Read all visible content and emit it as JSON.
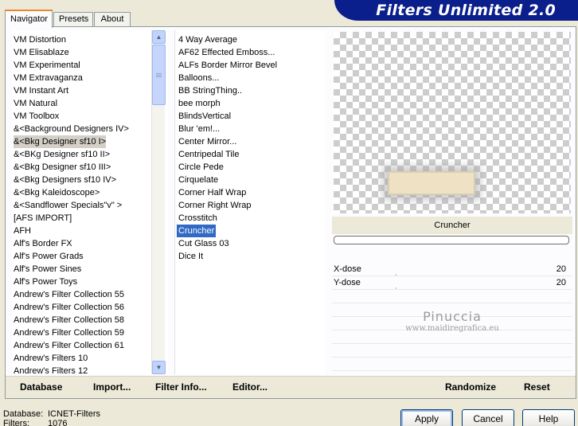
{
  "app": {
    "banner_title": "Filters Unlimited 2.0"
  },
  "tabs": [
    {
      "label": "Navigator",
      "active": true
    },
    {
      "label": "Presets",
      "active": false
    },
    {
      "label": "About",
      "active": false
    }
  ],
  "categories": {
    "items": [
      "VM Distortion",
      "VM Elisablaze",
      "VM Experimental",
      "VM Extravaganza",
      "VM Instant Art",
      "VM Natural",
      "VM Toolbox",
      "&<Background Designers IV>",
      "&<Bkg Designer sf10 I>",
      "&<BKg Designer sf10 II>",
      "&<Bkg Designer sf10 III>",
      "&<Bkg Designers sf10 IV>",
      "&<Bkg Kaleidoscope>",
      "&<Sandflower Specials\"v\" >",
      "[AFS IMPORT]",
      "AFH",
      "Alf's Border FX",
      "Alf's Power Grads",
      "Alf's Power Sines",
      "Alf's Power Toys",
      "Andrew's Filter Collection 55",
      "Andrew's Filter Collection 56",
      "Andrew's Filter Collection 58",
      "Andrew's Filter Collection 59",
      "Andrew's Filter Collection 61",
      "Andrew's Filters 10",
      "Andrew's Filters 12"
    ],
    "selected_index": 8
  },
  "filters": {
    "items": [
      "4 Way Average",
      "AF62 Effected Emboss...",
      "ALFs Border Mirror Bevel",
      "Balloons...",
      "BB StringThing..",
      "bee morph",
      "BlindsVertical",
      "Blur 'em!...",
      "Center Mirror...",
      "Centripedal Tile",
      "Circle Pede",
      "Cirquelate",
      "Corner Half Wrap",
      "Corner Right Wrap",
      "Crosstitch",
      "Cruncher",
      "Cut Glass  03",
      "Dice It"
    ],
    "selected_index": 15
  },
  "preview": {
    "filter_name": "Cruncher",
    "progress": 0
  },
  "params": [
    {
      "label": "X-dose",
      "value": "20"
    },
    {
      "label": "Y-dose",
      "value": "20"
    }
  ],
  "watermark": {
    "line1": "Pinuccia",
    "line2": "www.maidiregrafica.eu"
  },
  "toolbar": {
    "database": "Database",
    "import": "Import...",
    "filter_info": "Filter Info...",
    "editor": "Editor...",
    "randomize": "Randomize",
    "reset": "Reset"
  },
  "info": {
    "database_label": "Database:",
    "database_value": "ICNET-Filters",
    "filters_label": "Filters:",
    "filters_value": "1076"
  },
  "dialog": {
    "apply": "Apply",
    "cancel": "Cancel",
    "help": "Help"
  },
  "colors": {
    "banner": "#0a1e8c",
    "selection": "#316ac5",
    "tab_accent": "#e68b2c"
  }
}
